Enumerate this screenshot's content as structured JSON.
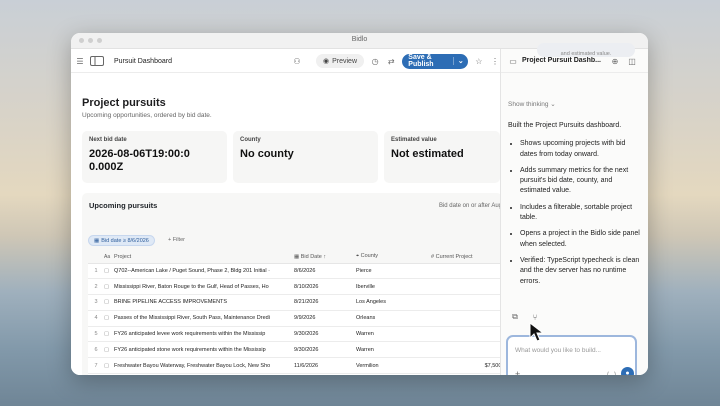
{
  "window": {
    "title": "Bidlo"
  },
  "toolbar": {
    "page_title": "Pursuit Dashboard",
    "preview_label": "Preview",
    "publish_label": "Save & Publish"
  },
  "page": {
    "heading": "Project pursuits",
    "subheading": "Upcoming opportunities, ordered by bid date."
  },
  "cards": [
    {
      "label": "Next bid date",
      "value": "2026-08-06T19:00:00.000Z"
    },
    {
      "label": "County",
      "value": "No county"
    },
    {
      "label": "Estimated value",
      "value": "Not estimated"
    }
  ],
  "section": {
    "title": "Upcoming pursuits",
    "right_text": "Bid date on or after Aug",
    "filter_chip": "Bid date ≥ 8/6/2026",
    "add_filter": "+ Filter"
  },
  "table": {
    "columns": [
      "Project",
      "Bid Date ↑",
      "County",
      "Current Project"
    ],
    "rows": [
      {
        "n": "1",
        "project": "Q702--American Lake / Puget Sound, Phase 2, Bldg 201 Initial ·",
        "date": "8/6/2026",
        "county": "Pierce",
        "value": ""
      },
      {
        "n": "2",
        "project": "Mississippi River, Baton Rouge to the Gulf, Head of Passes, Ho",
        "date": "8/10/2026",
        "county": "Iberville",
        "value": ""
      },
      {
        "n": "3",
        "project": "BRINE PIPELINE ACCESS IMPROVEMENTS",
        "date": "8/21/2026",
        "county": "Los Angeles",
        "value": ""
      },
      {
        "n": "4",
        "project": "Passes of the Mississippi River, South Pass, Maintenance Dredi",
        "date": "9/9/2026",
        "county": "Orleans",
        "value": ""
      },
      {
        "n": "5",
        "project": "FY26 anticipated levee work requirements within the Mississip",
        "date": "9/30/2026",
        "county": "Warren",
        "value": ""
      },
      {
        "n": "6",
        "project": "FY26 anticipated stone work requirements within the Mississip",
        "date": "9/30/2026",
        "county": "Warren",
        "value": ""
      },
      {
        "n": "7",
        "project": "Freshwater Bayou Waterway, Freshwater Bayou Lock, New Sho",
        "date": "11/6/2026",
        "county": "Vermilion",
        "value": "$7,500,0"
      },
      {
        "n": "8",
        "project": "Mississippi River, Baton Rouge to Gulf of Mexico, Southwest Pa",
        "date": "12/1/2026",
        "county": "Iberville",
        "value": ""
      }
    ]
  },
  "chat": {
    "title": "Project Pursuit Dashb...",
    "top_pill": "and estimated value.",
    "show_thinking": "Show thinking",
    "intro": "Built the Project Pursuits dashboard.",
    "bullets": [
      "Shows upcoming projects with bid dates from today onward.",
      "Adds summary metrics for the next pursuit's bid date, county, and estimated value.",
      "Includes a filterable, sortable project table.",
      "Opens a project in the Bidlo side panel when selected.",
      "Verified: TypeScript typecheck is clean and the dev server has no runtime errors."
    ],
    "input_placeholder": "What would you like to build..."
  },
  "colors": {
    "accent": "#2d6db5",
    "chip_bg": "#dfe9f6"
  }
}
